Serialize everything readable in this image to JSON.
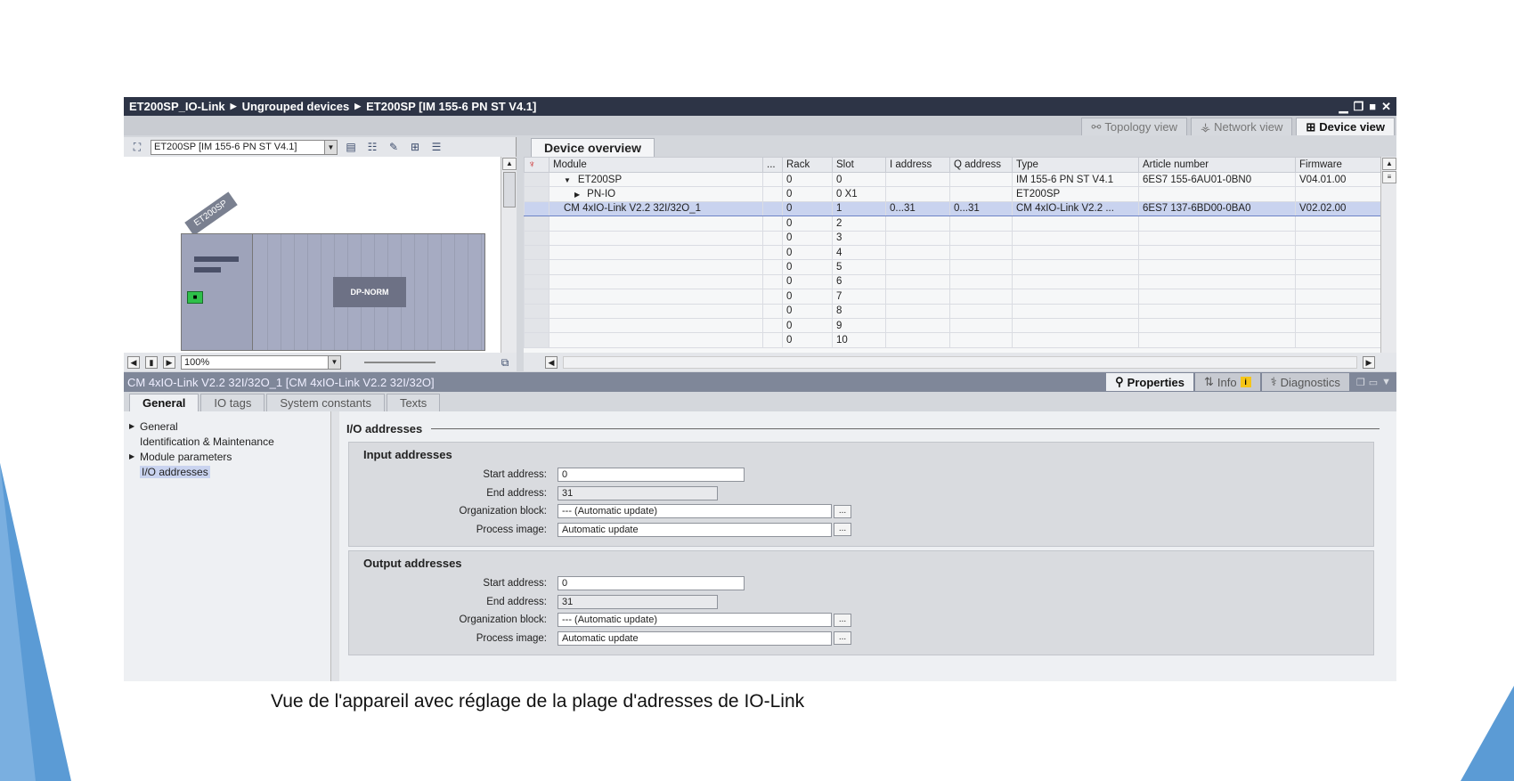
{
  "window": {
    "breadcrumb": [
      "ET200SP_IO-Link",
      "Ungrouped devices",
      "ET200SP [IM 155-6 PN ST V4.1]"
    ],
    "controls": [
      "▁",
      "❐",
      "■",
      "✕"
    ]
  },
  "view_tabs": {
    "topology": "Topology view",
    "network": "Network view",
    "device": "Device view"
  },
  "left_pane": {
    "device_select": "ET200SP [IM 155-6 PN ST V4.1]",
    "rack_label": "ET200SP",
    "module_label": "DP-NORM",
    "zoom": "100%"
  },
  "overview": {
    "tab_label": "Device overview",
    "columns": [
      "",
      "Module",
      "...",
      "Rack",
      "Slot",
      "I address",
      "Q address",
      "Type",
      "Article number",
      "Firmware"
    ],
    "rows": [
      {
        "indent": 1,
        "toggle": "▼",
        "module": "ET200SP",
        "rack": "0",
        "slot": "0",
        "i_address": "",
        "q_address": "",
        "type": "IM 155-6 PN ST V4.1",
        "article": "6ES7 155-6AU01-0BN0",
        "firmware": "V04.01.00"
      },
      {
        "indent": 2,
        "toggle": "▶",
        "module": "PN-IO",
        "rack": "0",
        "slot": "0 X1",
        "i_address": "",
        "q_address": "",
        "type": "ET200SP",
        "article": "",
        "firmware": ""
      },
      {
        "indent": 1,
        "toggle": "",
        "module": "CM 4xIO-Link V2.2 32I/32O_1",
        "rack": "0",
        "slot": "1",
        "i_address": "0...31",
        "q_address": "0...31",
        "type": "CM 4xIO-Link V2.2 ...",
        "article": "6ES7 137-6BD00-0BA0",
        "firmware": "V02.02.00",
        "selected": true
      },
      {
        "indent": 0,
        "toggle": "",
        "module": "",
        "rack": "0",
        "slot": "2",
        "i_address": "",
        "q_address": "",
        "type": "",
        "article": "",
        "firmware": ""
      },
      {
        "indent": 0,
        "toggle": "",
        "module": "",
        "rack": "0",
        "slot": "3",
        "i_address": "",
        "q_address": "",
        "type": "",
        "article": "",
        "firmware": ""
      },
      {
        "indent": 0,
        "toggle": "",
        "module": "",
        "rack": "0",
        "slot": "4",
        "i_address": "",
        "q_address": "",
        "type": "",
        "article": "",
        "firmware": ""
      },
      {
        "indent": 0,
        "toggle": "",
        "module": "",
        "rack": "0",
        "slot": "5",
        "i_address": "",
        "q_address": "",
        "type": "",
        "article": "",
        "firmware": ""
      },
      {
        "indent": 0,
        "toggle": "",
        "module": "",
        "rack": "0",
        "slot": "6",
        "i_address": "",
        "q_address": "",
        "type": "",
        "article": "",
        "firmware": ""
      },
      {
        "indent": 0,
        "toggle": "",
        "module": "",
        "rack": "0",
        "slot": "7",
        "i_address": "",
        "q_address": "",
        "type": "",
        "article": "",
        "firmware": ""
      },
      {
        "indent": 0,
        "toggle": "",
        "module": "",
        "rack": "0",
        "slot": "8",
        "i_address": "",
        "q_address": "",
        "type": "",
        "article": "",
        "firmware": ""
      },
      {
        "indent": 0,
        "toggle": "",
        "module": "",
        "rack": "0",
        "slot": "9",
        "i_address": "",
        "q_address": "",
        "type": "",
        "article": "",
        "firmware": ""
      },
      {
        "indent": 0,
        "toggle": "",
        "module": "",
        "rack": "0",
        "slot": "10",
        "i_address": "",
        "q_address": "",
        "type": "",
        "article": "",
        "firmware": ""
      }
    ]
  },
  "inspector": {
    "title": "CM 4xIO-Link V2.2 32I/32O_1 [CM 4xIO-Link V2.2 32I/32O]",
    "properties": "Properties",
    "info": "Info",
    "info_badge": "i",
    "diagnostics": "Diagnostics"
  },
  "prop_tabs": [
    "General",
    "IO tags",
    "System constants",
    "Texts"
  ],
  "tree": [
    {
      "label": "General",
      "toggle": "▶",
      "selected": false
    },
    {
      "label": "Identification & Maintenance",
      "toggle": "",
      "selected": false
    },
    {
      "label": "Module parameters",
      "toggle": "▶",
      "selected": false
    },
    {
      "label": "I/O addresses",
      "toggle": "",
      "selected": true
    }
  ],
  "io": {
    "heading": "I/O addresses",
    "input": {
      "title": "Input addresses",
      "start_label": "Start address:",
      "start_value": "0",
      "end_label": "End address:",
      "end_value": "31",
      "ob_label": "Organization block:",
      "ob_value": "--- (Automatic update)",
      "pi_label": "Process image:",
      "pi_value": "Automatic update"
    },
    "output": {
      "title": "Output addresses",
      "start_label": "Start address:",
      "start_value": "0",
      "end_label": "End address:",
      "end_value": "31",
      "ob_label": "Organization block:",
      "ob_value": "--- (Automatic update)",
      "pi_label": "Process image:",
      "pi_value": "Automatic update"
    }
  },
  "caption": "Vue de l'appareil avec réglage de la plage d'adresses de IO-Link",
  "colors": {
    "titlebar": "#2d3446",
    "selection": "#c9d3ef",
    "accent": "#5b9bd5"
  }
}
